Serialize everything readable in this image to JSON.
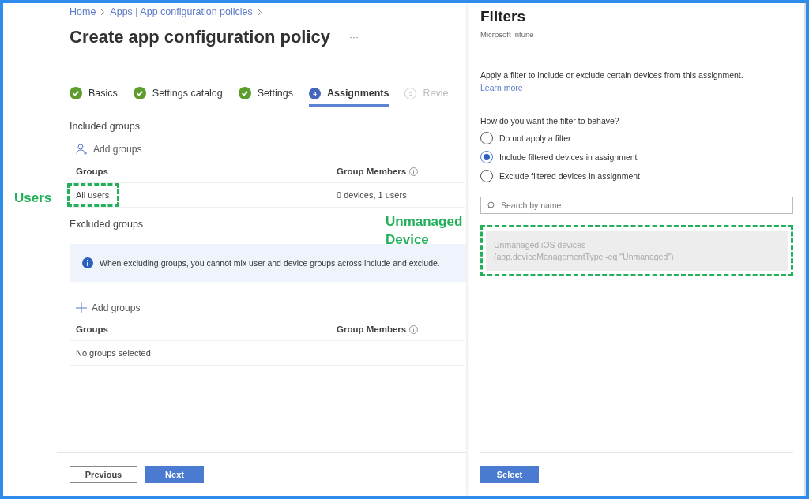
{
  "breadcrumb": [
    "Home",
    "Apps | App configuration policies"
  ],
  "title": "Create app configuration policy",
  "more": "···",
  "steps": [
    {
      "label": "Basics",
      "kind": "done",
      "selected": false
    },
    {
      "label": "Settings catalog",
      "kind": "done",
      "selected": false
    },
    {
      "label": "Settings",
      "kind": "done",
      "selected": false
    },
    {
      "label": "Assignments",
      "kind": "current",
      "number": "4",
      "selected": true
    },
    {
      "label": "Revie",
      "kind": "pending",
      "number": "5",
      "selected": false
    }
  ],
  "included": {
    "heading": "Included groups",
    "add": "Add groups",
    "columns": [
      "Groups",
      "Group Members"
    ],
    "rows": [
      {
        "group": "All users",
        "members": "0 devices, 1 users",
        "highlighted": true
      }
    ]
  },
  "excluded": {
    "heading": "Excluded groups",
    "info": "When excluding groups, you cannot mix user and device groups across include and exclude.",
    "add": "Add groups",
    "columns": [
      "Groups",
      "Group Members"
    ],
    "empty": "No groups selected"
  },
  "footer": {
    "buttons": [
      {
        "label": "Previous",
        "kind": "secondary"
      },
      {
        "label": "Next",
        "kind": "primary"
      }
    ]
  },
  "filters": {
    "title": "Filters",
    "subtitle": "Microsoft Intune",
    "description": "Apply a filter to include or exclude certain devices from this assignment.",
    "link": "Learn more",
    "question": "How do you want the filter to behave?",
    "options": [
      {
        "label": "Do not apply a filter",
        "selected": false
      },
      {
        "label": "Include filtered devices in assignment",
        "selected": true
      },
      {
        "label": "Exclude filtered devices in assignment",
        "selected": false
      }
    ],
    "search": {
      "placeholder": "Search by name"
    },
    "items": [
      {
        "name": "Unmanaged iOS devices",
        "rule": "(app.deviceManagementType -eq \"Unmanaged\")",
        "highlighted": true
      }
    ],
    "button": "Select"
  },
  "annotations": [
    {
      "text": "Users"
    },
    {
      "text": "Unmanaged\nDevice"
    }
  ]
}
